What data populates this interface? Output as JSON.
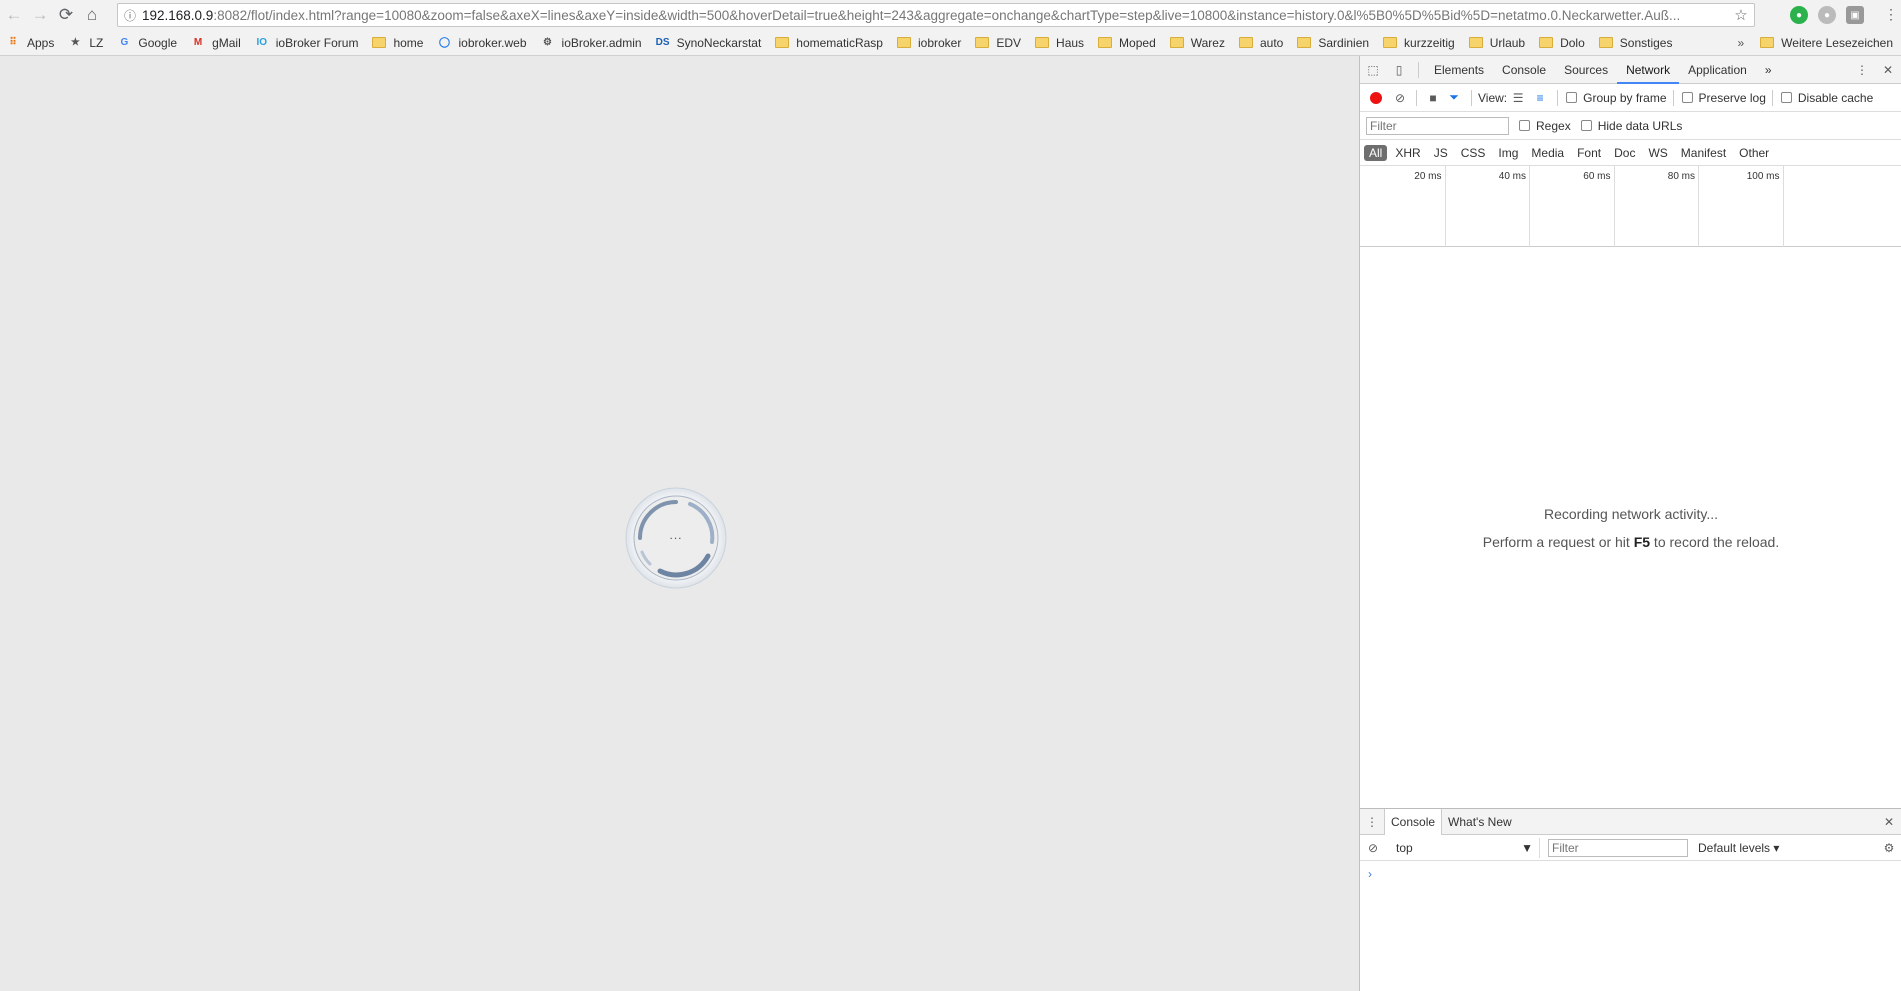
{
  "browser": {
    "url_host": "192.168.0.9",
    "url_rest": ":8082/flot/index.html?range=10080&zoom=false&axeX=lines&axeY=inside&width=500&hoverDetail=true&height=243&aggregate=onchange&chartType=step&live=10800&instance=history.0&l%5B0%5D%5Bid%5D=netatmo.0.Neckarwetter.Auß..."
  },
  "bookmarks": {
    "items": [
      {
        "label": "Apps",
        "icon": "apps-grid-icon"
      },
      {
        "label": "LZ",
        "icon": "star-icon"
      },
      {
        "label": "Google",
        "icon": "google-icon"
      },
      {
        "label": "gMail",
        "icon": "gmail-icon"
      },
      {
        "label": "ioBroker Forum",
        "icon": "iobroker-icon"
      },
      {
        "label": "home",
        "icon": "folder-icon"
      },
      {
        "label": "iobroker.web",
        "icon": "globe-icon"
      },
      {
        "label": "ioBroker.admin",
        "icon": "gear-icon"
      },
      {
        "label": "SynoNeckarstat",
        "icon": "dsm-icon"
      },
      {
        "label": "homematicRasp",
        "icon": "folder-icon"
      },
      {
        "label": "iobroker",
        "icon": "folder-icon"
      },
      {
        "label": "EDV",
        "icon": "folder-icon"
      },
      {
        "label": "Haus",
        "icon": "folder-icon"
      },
      {
        "label": "Moped",
        "icon": "folder-icon"
      },
      {
        "label": "Warez",
        "icon": "folder-icon"
      },
      {
        "label": "auto",
        "icon": "folder-icon"
      },
      {
        "label": "Sardinien",
        "icon": "folder-icon"
      },
      {
        "label": "kurzzeitig",
        "icon": "folder-icon"
      },
      {
        "label": "Urlaub",
        "icon": "folder-icon"
      },
      {
        "label": "Dolo",
        "icon": "folder-icon"
      },
      {
        "label": "Sonstiges",
        "icon": "folder-icon"
      }
    ],
    "more": "»",
    "other": "Weitere Lesezeichen"
  },
  "page": {
    "spinner_text": "..."
  },
  "devtools": {
    "tabs": [
      "Elements",
      "Console",
      "Sources",
      "Network",
      "Application"
    ],
    "active_tab": "Network",
    "more_tabs": "»",
    "toolbar": {
      "view_label": "View:",
      "group_by_frame": "Group by frame",
      "preserve_log": "Preserve log",
      "disable_cache": "Disable cache"
    },
    "filter": {
      "placeholder": "Filter",
      "regex": "Regex",
      "hide_data_urls": "Hide data URLs"
    },
    "types": [
      "All",
      "XHR",
      "JS",
      "CSS",
      "Img",
      "Media",
      "Font",
      "Doc",
      "WS",
      "Manifest",
      "Other"
    ],
    "timeline_ticks": [
      "20 ms",
      "40 ms",
      "60 ms",
      "80 ms",
      "100 ms"
    ],
    "empty": {
      "line1": "Recording network activity...",
      "line2_pre": "Perform a request or hit ",
      "line2_key": "F5",
      "line2_post": " to record the reload."
    },
    "drawer": {
      "tabs": [
        "Console",
        "What's New"
      ],
      "context": "top",
      "filter_placeholder": "Filter",
      "levels": "Default levels"
    }
  }
}
